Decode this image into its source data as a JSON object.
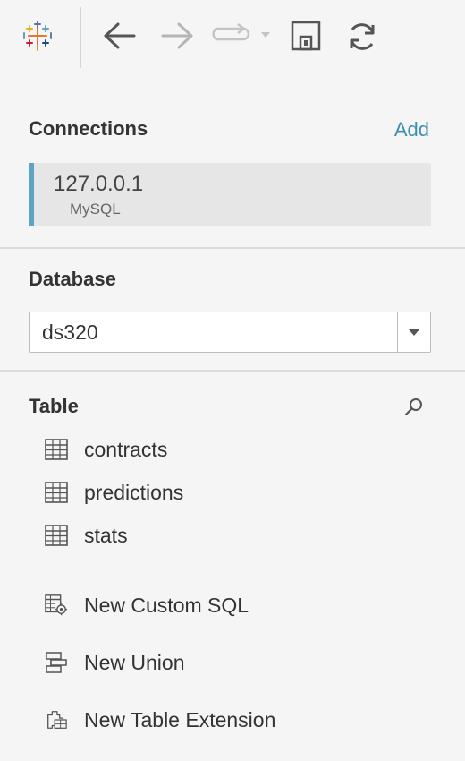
{
  "toolbar": {
    "logo_icon": "tableau-logo-icon",
    "back_icon": "arrow-left-icon",
    "forward_icon": "arrow-right-icon",
    "redo_icon": "redo-icon",
    "save_icon": "save-icon",
    "refresh_icon": "refresh-icon"
  },
  "connections": {
    "title": "Connections",
    "add_label": "Add",
    "items": [
      {
        "host": "127.0.0.1",
        "type": "MySQL"
      }
    ]
  },
  "database": {
    "title": "Database",
    "selected": "ds320"
  },
  "tables": {
    "title": "Table",
    "items": [
      {
        "label": "contracts"
      },
      {
        "label": "predictions"
      },
      {
        "label": "stats"
      }
    ]
  },
  "actions": {
    "custom_sql": "New Custom SQL",
    "union": "New Union",
    "table_extension": "New Table Extension"
  },
  "colors": {
    "accent": "#3d8fb0",
    "connection_bar": "#5fa4c6",
    "background": "#f5f5f5"
  }
}
